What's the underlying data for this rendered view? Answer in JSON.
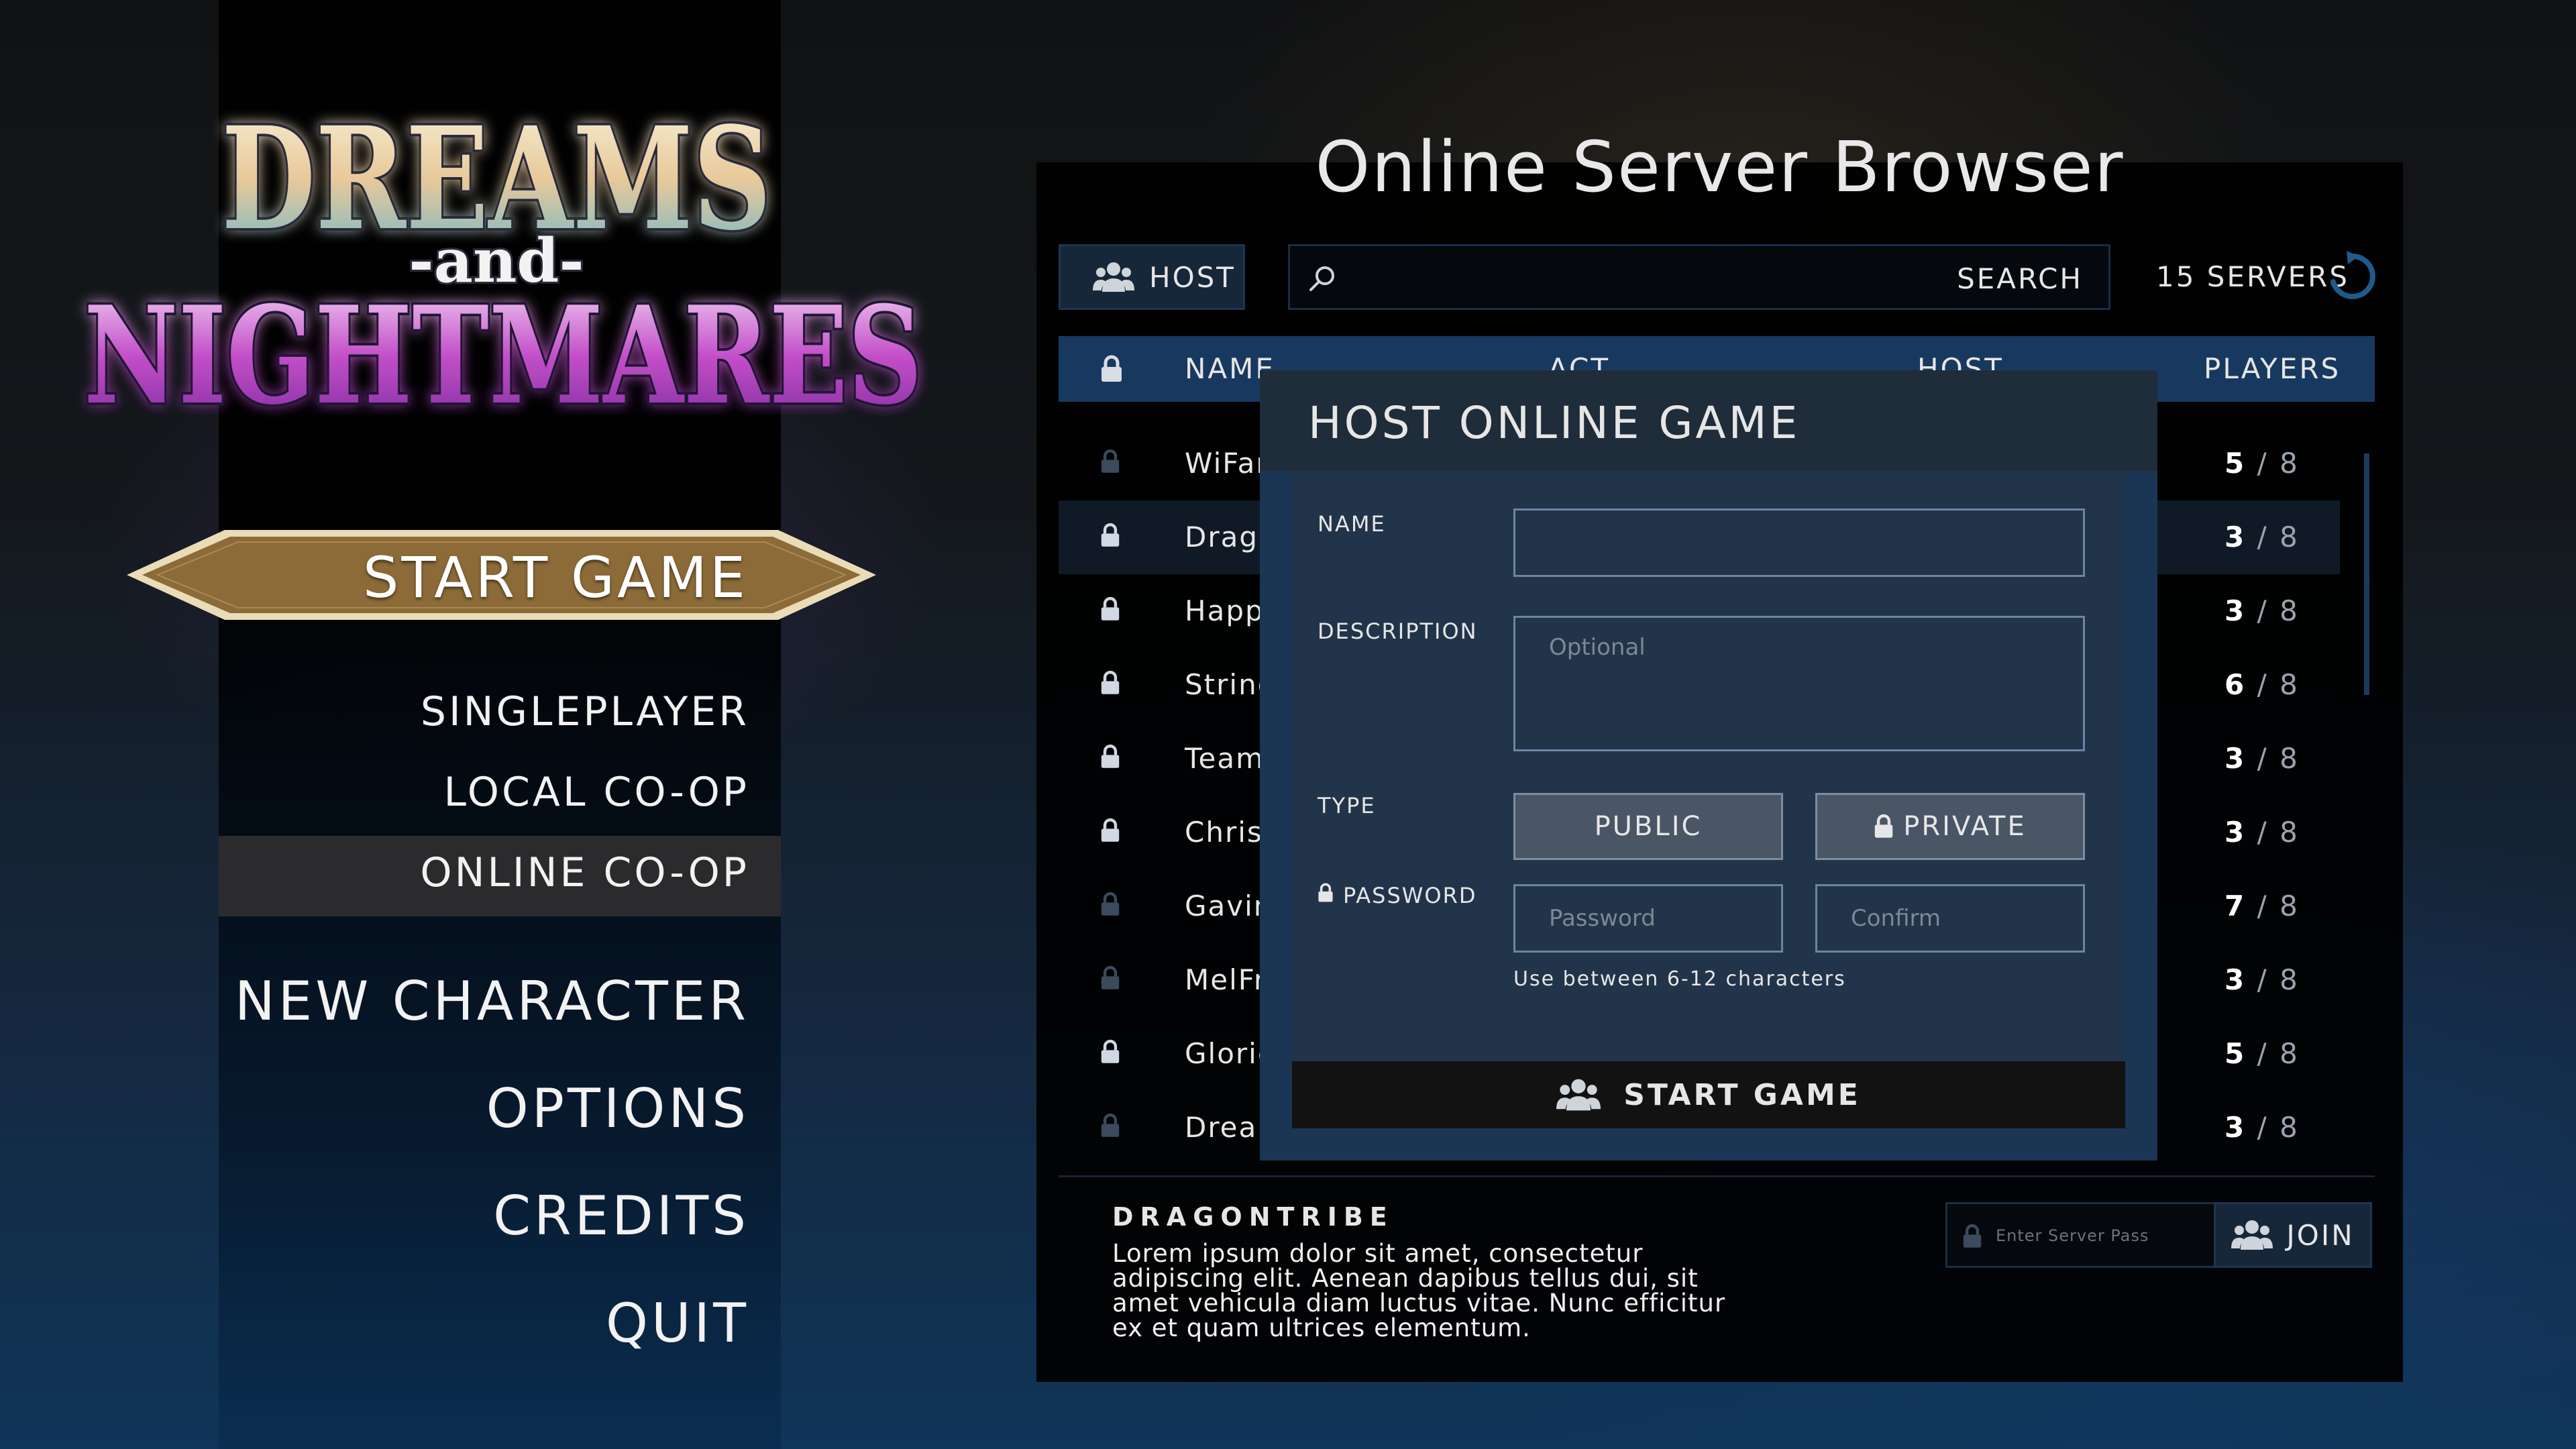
{
  "logo": {
    "line1": "DREAMS",
    "line2": "-and-",
    "line3": "NIGHTMARES"
  },
  "menu": {
    "start_game": "START GAME",
    "singleplayer": "SINGLEPLAYER",
    "local_coop": "LOCAL CO-OP",
    "online_coop": "ONLINE CO-OP",
    "new_character": "NEW CHARACTER",
    "options": "OPTIONS",
    "credits": "CREDITS",
    "quit": "QUIT"
  },
  "browser": {
    "title": "Online Server Browser",
    "host_label": "HOST",
    "search_label": "SEARCH",
    "server_count": "15 SERVERS",
    "columns": {
      "name": "NAME",
      "act": "ACT",
      "host": "HOST",
      "players": "PLAYERS"
    },
    "rows": [
      {
        "name": "WiFan",
        "players": "5",
        "max": "8"
      },
      {
        "name": "Drago",
        "players": "3",
        "max": "8"
      },
      {
        "name": "Happy",
        "players": "3",
        "max": "8"
      },
      {
        "name": "String",
        "players": "6",
        "max": "8"
      },
      {
        "name": "TeamH",
        "players": "3",
        "max": "8"
      },
      {
        "name": "Christ",
        "players": "3",
        "max": "8"
      },
      {
        "name": "Gavin",
        "players": "7",
        "max": "8"
      },
      {
        "name": "MelFri",
        "players": "3",
        "max": "8"
      },
      {
        "name": "Glorio",
        "players": "5",
        "max": "8"
      },
      {
        "name": "Dream",
        "players": "3",
        "max": "8"
      }
    ],
    "selected_server": {
      "name": "DRAGONTRIBE",
      "description": "Lorem ipsum dolor sit amet, consectetur adipiscing elit. Aenean dapibus tellus dui, sit amet vehicula diam luctus vitae. Nunc efficitur ex et quam ultrices elementum."
    },
    "join": {
      "password_placeholder": "Enter Server Password ...",
      "label": "JOIN"
    }
  },
  "dialog": {
    "title": "HOST ONLINE GAME",
    "name_label": "NAME",
    "name_value": "",
    "description_label": "DESCRIPTION",
    "description_placeholder": "Optional",
    "type_label": "TYPE",
    "public_label": "PUBLIC",
    "private_label": "PRIVATE",
    "password_label": "PASSWORD",
    "password_placeholder": "Password",
    "confirm_placeholder": "Confirm",
    "password_hint": "Use between 6-12 characters",
    "start_label": "START GAME"
  },
  "colors": {
    "accent_blue": "#18395f",
    "banner_gold": "#8a6a36",
    "dialog_bg": "#22344a"
  }
}
